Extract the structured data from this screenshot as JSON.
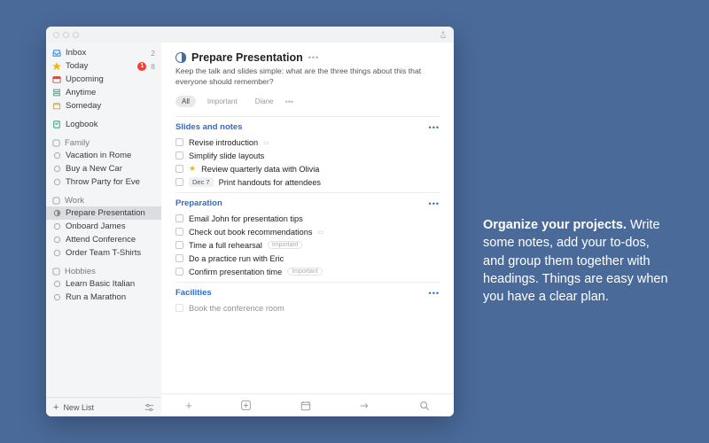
{
  "sidebar": {
    "smart_lists": [
      {
        "id": "inbox",
        "label": "Inbox",
        "count": "2",
        "color": "#2f8fe6",
        "glyph": "tray"
      },
      {
        "id": "today",
        "label": "Today",
        "badge": "1",
        "count": "8",
        "color": "#f5b400",
        "glyph": "star",
        "active": true
      },
      {
        "id": "upcoming",
        "label": "Upcoming",
        "color": "#d04a4a",
        "glyph": "calendar"
      },
      {
        "id": "anytime",
        "label": "Anytime",
        "color": "#3aa97a",
        "glyph": "stack"
      },
      {
        "id": "someday",
        "label": "Someday",
        "color": "#c7a86a",
        "glyph": "box"
      }
    ],
    "logbook_label": "Logbook",
    "areas": [
      {
        "name": "Family",
        "projects": [
          {
            "label": "Vacation in Rome"
          },
          {
            "label": "Buy a New Car"
          },
          {
            "label": "Throw Party for Eve"
          }
        ]
      },
      {
        "name": "Work",
        "projects": [
          {
            "label": "Prepare Presentation",
            "selected": true,
            "progress": 0.5
          },
          {
            "label": "Onboard James"
          },
          {
            "label": "Attend Conference"
          },
          {
            "label": "Order Team T-Shirts"
          }
        ]
      },
      {
        "name": "Hobbies",
        "projects": [
          {
            "label": "Learn Basic Italian"
          },
          {
            "label": "Run a Marathon"
          }
        ]
      }
    ],
    "new_list_label": "New List"
  },
  "project": {
    "title": "Prepare Presentation",
    "notes": "Keep the talk and slides simple: what are the three things about this that everyone should remember?",
    "tags": [
      "All",
      "Important",
      "Diane"
    ],
    "sections": [
      {
        "heading": "Slides and notes",
        "todos": [
          {
            "title": "Revise introduction",
            "note": true
          },
          {
            "title": "Simplify slide layouts"
          },
          {
            "title": "Review quarterly data with Olivia",
            "today": true
          },
          {
            "title": "Print handouts for attendees",
            "when": "Dec 7"
          }
        ]
      },
      {
        "heading": "Preparation",
        "todos": [
          {
            "title": "Email John for presentation tips"
          },
          {
            "title": "Check out book recommendations",
            "note": true
          },
          {
            "title": "Time a full rehearsal",
            "tag": "Important"
          },
          {
            "title": "Do a practice run with Eric"
          },
          {
            "title": "Confirm presentation time",
            "tag": "Important"
          }
        ]
      },
      {
        "heading": "Facilities",
        "todos": [
          {
            "title": "Book the conference room"
          }
        ]
      }
    ]
  },
  "promo": {
    "headline": "Organize your projects.",
    "body": "Write some notes, add your to-dos, and group them together with headings. Things are easy when you have a clear plan."
  }
}
